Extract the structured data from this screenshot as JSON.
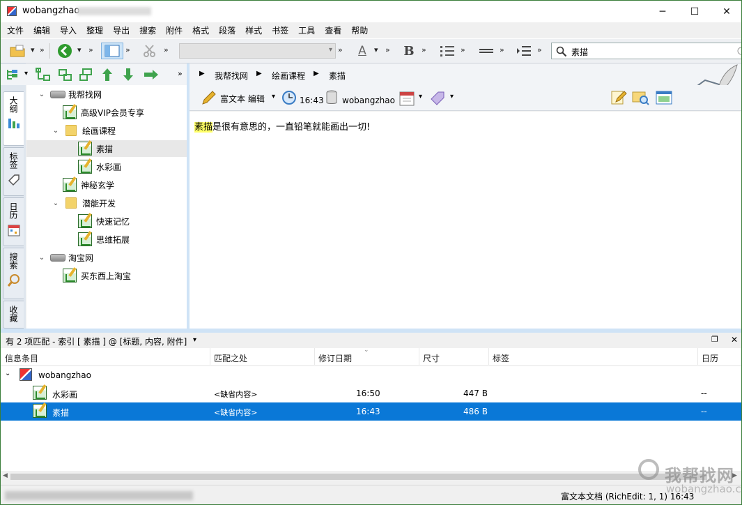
{
  "window": {
    "title": "wobangzhao",
    "minimize_glyph": "─",
    "maximize_glyph": "☐",
    "close_glyph": "✕"
  },
  "menu": [
    "文件",
    "编辑",
    "导入",
    "整理",
    "导出",
    "搜索",
    "附件",
    "格式",
    "段落",
    "样式",
    "书签",
    "工具",
    "查看",
    "帮助"
  ],
  "toolbar": {
    "search_value": "素描",
    "bold_glyph": "B",
    "font_color_glyph": "A"
  },
  "vtabs": [
    "大纲",
    "标签",
    "日历",
    "搜索",
    "收藏"
  ],
  "tree": [
    {
      "label": "我帮找网",
      "type": "db",
      "level": 0,
      "toggle": "⌄"
    },
    {
      "label": "高级VIP会员专享",
      "type": "note",
      "level": 1
    },
    {
      "label": "绘画课程",
      "type": "folder",
      "level": 1,
      "toggle": "⌄"
    },
    {
      "label": "素描",
      "type": "note",
      "level": 2,
      "selected": true
    },
    {
      "label": "水彩画",
      "type": "note",
      "level": 2
    },
    {
      "label": "神秘玄学",
      "type": "note",
      "level": 1
    },
    {
      "label": "潜能开发",
      "type": "folder",
      "level": 1,
      "toggle": "⌄"
    },
    {
      "label": "快速记忆",
      "type": "note",
      "level": 2
    },
    {
      "label": "思维拓展",
      "type": "note",
      "level": 2
    },
    {
      "label": "淘宝网",
      "type": "db",
      "level": 0,
      "toggle": "⌄"
    },
    {
      "label": "买东西上淘宝",
      "type": "note",
      "level": 1
    }
  ],
  "breadcrumb": [
    "我帮找网",
    "绘画课程",
    "素描"
  ],
  "notebar": {
    "editor_mode": "富文本 编辑",
    "time": "16:43",
    "database": "wobangzhao"
  },
  "editor": {
    "highlight": "素描",
    "rest": "是很有意思的，一直铅笔就能画出一切!"
  },
  "results": {
    "summary": "有 2 项匹配 - 索引 [ 素描 ] @ [标题, 内容, 附件]",
    "columns": [
      "信息条目",
      "匹配之处",
      "修订日期",
      "尺寸",
      "标签",
      "日历"
    ],
    "group": "wobangzhao",
    "rows": [
      {
        "title": "水彩画",
        "match": "<缺省内容>",
        "date": "16:50",
        "size": "447 B",
        "calendar": "--",
        "selected": false
      },
      {
        "title": "素描",
        "match": "<缺省内容>",
        "date": "16:43",
        "size": "486 B",
        "calendar": "--",
        "selected": true
      }
    ]
  },
  "status": {
    "text": "富文本文档 (RichEdit: 1, 1)  16:43"
  },
  "watermark": {
    "big": "我帮找网",
    "small": "wobangzhao.com"
  },
  "colors": {
    "selection": "#0a78d7",
    "highlight": "#ffff66",
    "splitter": "#cfe3f6"
  }
}
